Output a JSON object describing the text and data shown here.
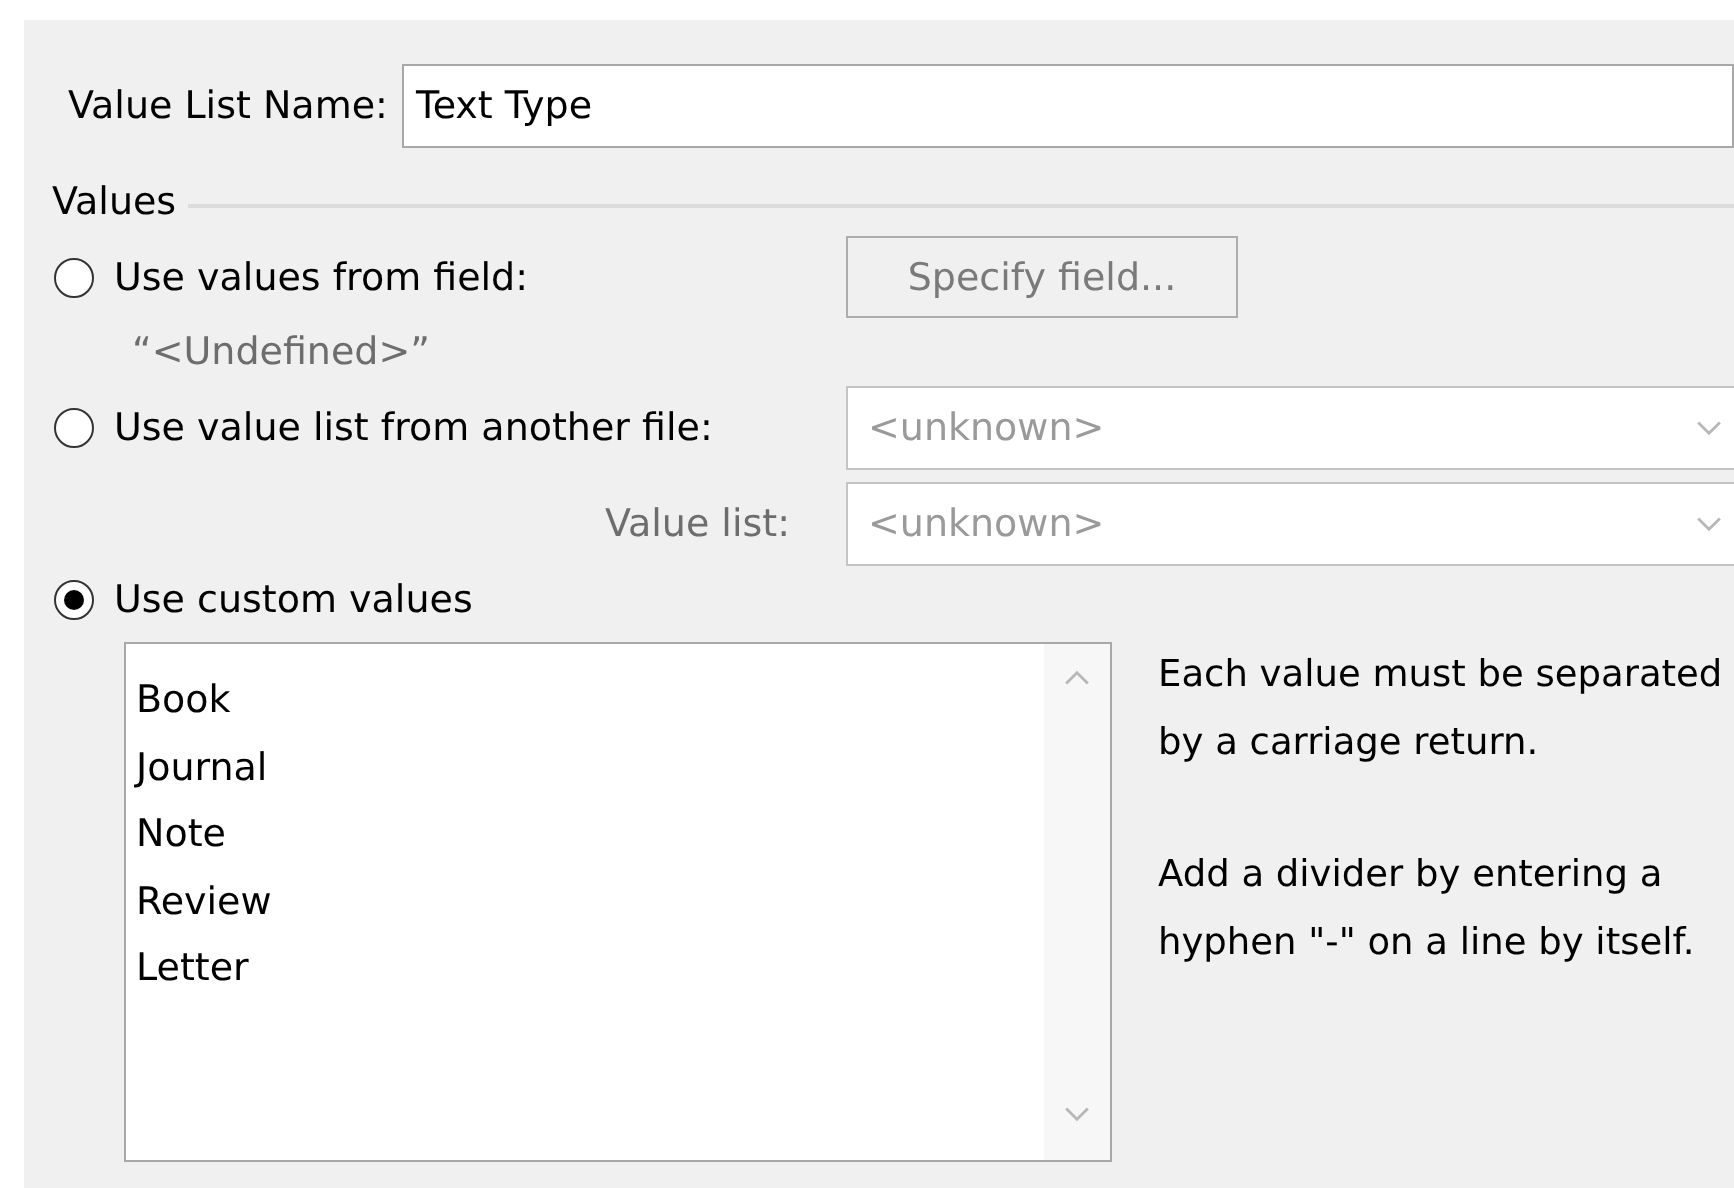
{
  "name_field": {
    "label": "Value List Name:",
    "value": "Text Type"
  },
  "values_group": {
    "title": "Values",
    "sources": [
      {
        "kind": "field",
        "label": "Use values from field:",
        "selected": false,
        "button": "Specify field...",
        "field_name": "“<Undefined>”"
      },
      {
        "kind": "file",
        "label": "Use value list from another file:",
        "selected": false,
        "dropdown": "<unknown>",
        "sub_label": "Value list:",
        "sub_dropdown": "<unknown>"
      },
      {
        "kind": "custom",
        "label": "Use custom values",
        "selected": true,
        "entries": [
          "Book",
          "Journal",
          "Note",
          "Review",
          "Letter"
        ],
        "help": [
          "Each value must be separated by a carriage return.",
          "Add a divider by entering a hyphen \"-\" on a line by itself."
        ]
      }
    ]
  }
}
